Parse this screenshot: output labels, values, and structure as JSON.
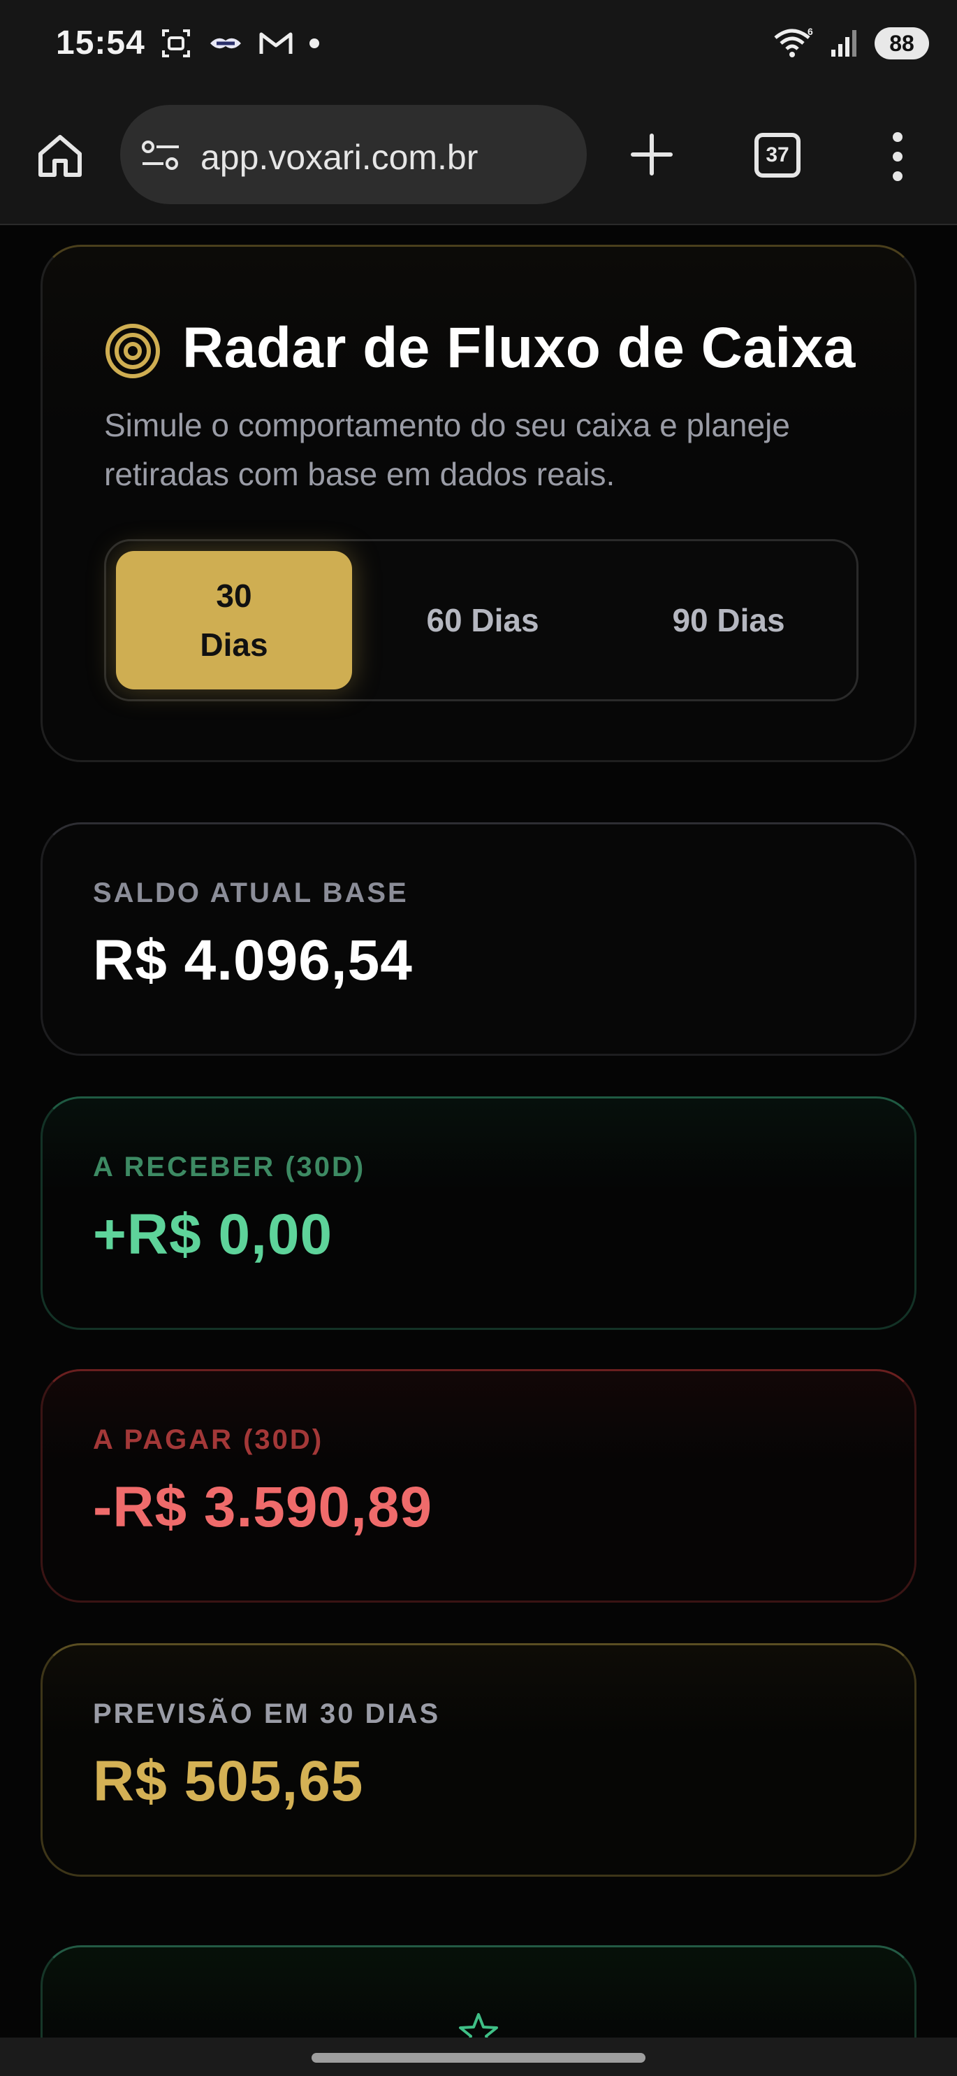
{
  "status_bar": {
    "time": "15:54",
    "battery": "88",
    "left_icons": [
      "screenshot-icon",
      "handshake-icon",
      "gmail-icon",
      "dot-icon"
    ],
    "right_icons": [
      "wifi-icon",
      "signal-icon",
      "battery-icon"
    ]
  },
  "browser": {
    "url": "app.voxari.com.br",
    "tab_count": "37",
    "icons": [
      "home-icon",
      "site-settings-icon",
      "plus-icon",
      "tabs-icon",
      "more-vert-icon"
    ]
  },
  "radar": {
    "icon": "target-icon",
    "title": "Radar de Fluxo de Caixa",
    "subtitle": "Simule o comportamento do seu caixa e planeje retiradas com base em dados reais.",
    "periods": [
      {
        "label_line1": "30",
        "label_line2": "Dias",
        "active": true
      },
      {
        "label": "60 Dias",
        "active": false
      },
      {
        "label": "90 Dias",
        "active": false
      }
    ]
  },
  "stats": {
    "saldo": {
      "label": "SALDO ATUAL BASE",
      "value": "R$ 4.096,54"
    },
    "receber": {
      "label": "A RECEBER (30D)",
      "value": "+R$ 0,00"
    },
    "pagar": {
      "label": "A PAGAR (30D)",
      "value": "-R$ 3.590,89"
    },
    "previsao": {
      "label": "PREVISÃO EM 30 DIAS",
      "value": "R$ 505,65"
    }
  },
  "bottom_card": {
    "icon": "star-icon"
  },
  "colors": {
    "accent_gold": "#cfae52",
    "positive_green": "#5ed39a",
    "negative_red": "#ef6b6b",
    "forecast_gold": "#d4b155"
  }
}
